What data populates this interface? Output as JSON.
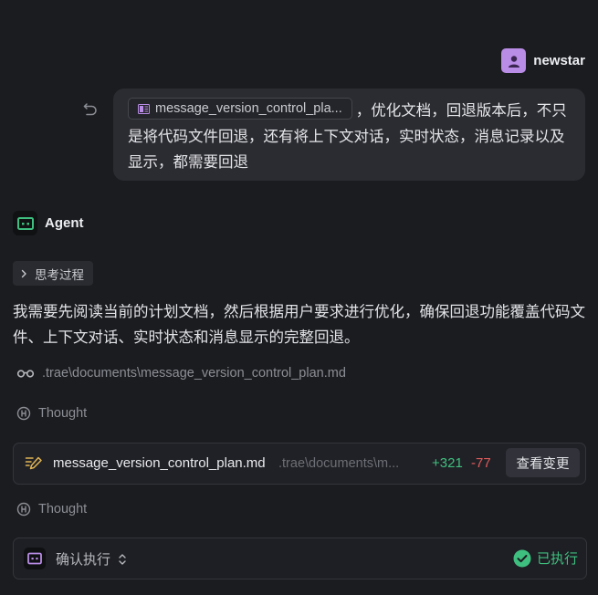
{
  "user": {
    "name": "newstar"
  },
  "message": {
    "attachment": "message_version_control_pla...",
    "text": "，优化文档，回退版本后，不只是将代码文件回退，还有将上下文对话，实时状态，消息记录以及显示，都需要回退"
  },
  "agent": {
    "name": "Agent",
    "thinking_label": "思考过程",
    "response": "我需要先阅读当前的计划文档，然后根据用户要求进行优化，确保回退功能覆盖代码文件、上下文对话、实时状态和消息显示的完整回退。",
    "read_file": ".trae\\documents\\message_version_control_plan.md",
    "thought_1": "Thought",
    "thought_2": "Thought"
  },
  "edit_card": {
    "filename": "message_version_control_plan.md",
    "path": ".trae\\documents\\m...",
    "added": "+321",
    "removed": "-77",
    "view_button": "查看变更"
  },
  "execution": {
    "label": "确认执行",
    "status": "已执行"
  },
  "colors": {
    "background": "#1b1c20",
    "bubble": "#2b2c31",
    "user_avatar": "#b98ce6",
    "agent_accent": "#3fbf7f",
    "added": "#3fbf7f",
    "removed": "#e05b5b"
  },
  "icons": [
    "user-icon",
    "undo-icon",
    "file-icon",
    "agent-icon",
    "chevron-right-icon",
    "glasses-icon",
    "thought-icon",
    "edit-icon",
    "chevron-updown-icon",
    "check-circle-icon"
  ]
}
